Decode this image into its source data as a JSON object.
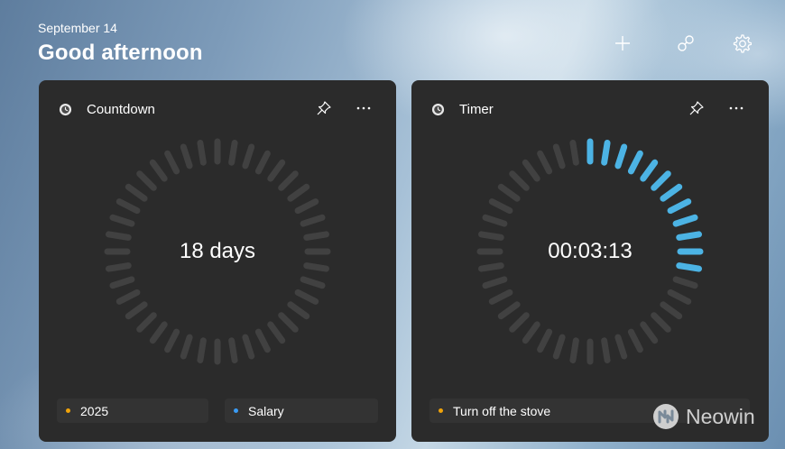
{
  "header": {
    "date": "September 14",
    "greeting": "Good afternoon",
    "add_icon": "plus-icon",
    "link_icon": "link-icon",
    "settings_icon": "gear-icon"
  },
  "widgets": [
    {
      "title": "Countdown",
      "icon": "clock-app-icon",
      "value": "18 days",
      "progress_fraction": 0,
      "chips": [
        {
          "label": "2025",
          "dot_color": "#f0a30a"
        },
        {
          "label": "Salary",
          "dot_color": "#3a9bf4"
        }
      ]
    },
    {
      "title": "Timer",
      "icon": "clock-app-icon",
      "value": "00:03:13",
      "progress_fraction": 0.29,
      "chips": [
        {
          "label": "Turn off the stove",
          "dot_color": "#f0a30a"
        }
      ]
    }
  ],
  "watermark": {
    "text": "Neowin"
  },
  "colors": {
    "card_bg": "#2b2b2b",
    "tick_inactive": "#414141",
    "tick_active": "#4cb3e4"
  }
}
